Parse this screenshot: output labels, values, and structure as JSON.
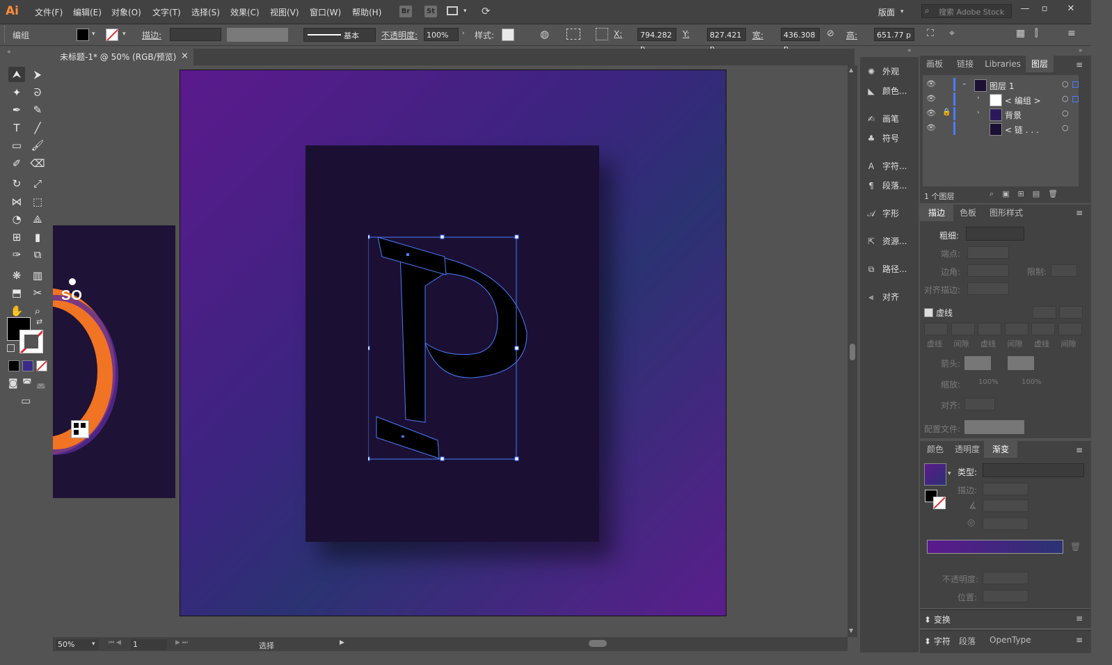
{
  "app": {
    "logo": "Ai"
  },
  "menu": [
    "文件(F)",
    "编辑(E)",
    "对象(O)",
    "文字(T)",
    "选择(S)",
    "效果(C)",
    "视图(V)",
    "窗口(W)",
    "帮助(H)"
  ],
  "appbar": {
    "br": "Br",
    "st": "St",
    "workspace": "版面",
    "search_placeholder": "搜索 Adobe Stock"
  },
  "control": {
    "selection_label": "编组",
    "stroke_label": "描边:",
    "stroke_style": "基本",
    "opacity_label": "不透明度:",
    "opacity_value": "100%",
    "style_label": "样式:",
    "x_label": "X:",
    "x_value": "794.282 p",
    "y_label": "Y:",
    "y_value": "827.421 p",
    "w_label": "宽:",
    "w_value": "436.308 p",
    "h_label": "高:",
    "h_value": "651.77 p"
  },
  "document": {
    "tab_title": "未标题-1* @ 50% (RGB/预览)",
    "close": "×",
    "artboard_text": "SO"
  },
  "statusbar": {
    "zoom": "50%",
    "page": "1",
    "tool": "选择"
  },
  "icon_panel": [
    {
      "icon": "appearance-icon",
      "label": "外观"
    },
    {
      "icon": "color-guide-icon",
      "label": "颜色..."
    },
    {
      "icon": "brush-icon",
      "label": "画笔"
    },
    {
      "icon": "symbol-icon",
      "label": "符号"
    },
    {
      "icon": "character-icon",
      "label": "字符..."
    },
    {
      "icon": "paragraph-icon",
      "label": "段落..."
    },
    {
      "icon": "glyph-icon",
      "label": "字形"
    },
    {
      "icon": "asset-export-icon",
      "label": "资源..."
    },
    {
      "icon": "pathfinder-icon",
      "label": "路径..."
    },
    {
      "icon": "align-icon",
      "label": "对齐"
    }
  ],
  "layers_panel": {
    "tabs": [
      "画板",
      "链接",
      "Libraries",
      "图层"
    ],
    "rows": [
      {
        "name": "图层 1"
      },
      {
        "name": "< 编组 >"
      },
      {
        "name": "背景"
      },
      {
        "name": "< 链 . . ."
      }
    ],
    "footer": "1 个图层"
  },
  "stroke_panel": {
    "tabs": [
      "描边",
      "色板",
      "图形样式"
    ],
    "weight_label": "粗细:",
    "cap_label": "端点:",
    "corner_label": "边角:",
    "limit_label": "限制:",
    "align_label": "对齐描边:",
    "dashed_label": "虚线",
    "dash_labels": [
      "虚线",
      "间隙",
      "虚线",
      "间隙",
      "虚线",
      "间隙"
    ],
    "arrow_label": "箭头:",
    "scale_label": "缩放:",
    "scale_values": [
      "100%",
      "100%"
    ],
    "align2_label": "对齐:",
    "profile_label": "配置文件:"
  },
  "gradient_panel": {
    "tabs": [
      "颜色",
      "透明度",
      "渐变"
    ],
    "type_label": "类型:",
    "stroke_label": "描边:",
    "opacity_label": "不透明度:",
    "location_label": "位置:"
  },
  "collapsed_panels": {
    "transform": "变换",
    "char_tabs": [
      "字符",
      "段落",
      "OpenType"
    ]
  },
  "colors": {
    "accent": "#4a7cff",
    "artboard_bg": "#1a0f30",
    "gradient_start": "#5b1a8c",
    "gradient_end": "#2b3272"
  }
}
